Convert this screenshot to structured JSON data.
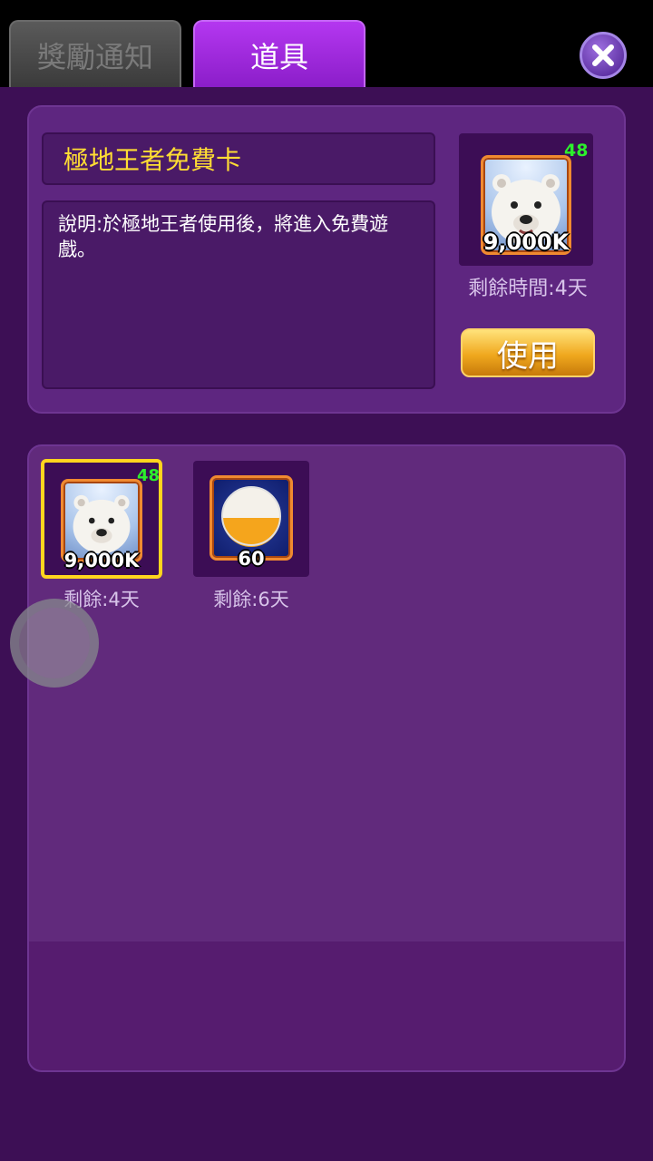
{
  "tabs": {
    "rewards_label": "獎勵通知",
    "items_label": "道具"
  },
  "selected_item": {
    "name": "極地王者免費卡",
    "description": "說明:於極地王者使用後，將進入免費遊戲。",
    "quantity": "48",
    "value": "9,000K",
    "remaining": "剩餘時間:4天",
    "use_label": "使用"
  },
  "inventory": {
    "items": [
      {
        "quantity": "48",
        "value": "9,000K",
        "remaining": "剩餘:4天",
        "icon": "polar-bear-icon"
      },
      {
        "value": "60",
        "remaining": "剩餘:6天",
        "icon": "orb-icon"
      }
    ]
  },
  "colors": {
    "accent_tab": "#9d2ad8",
    "title_text": "#ffdd33",
    "quantity_text": "#2cf02c",
    "use_button": "#f0a81e"
  }
}
